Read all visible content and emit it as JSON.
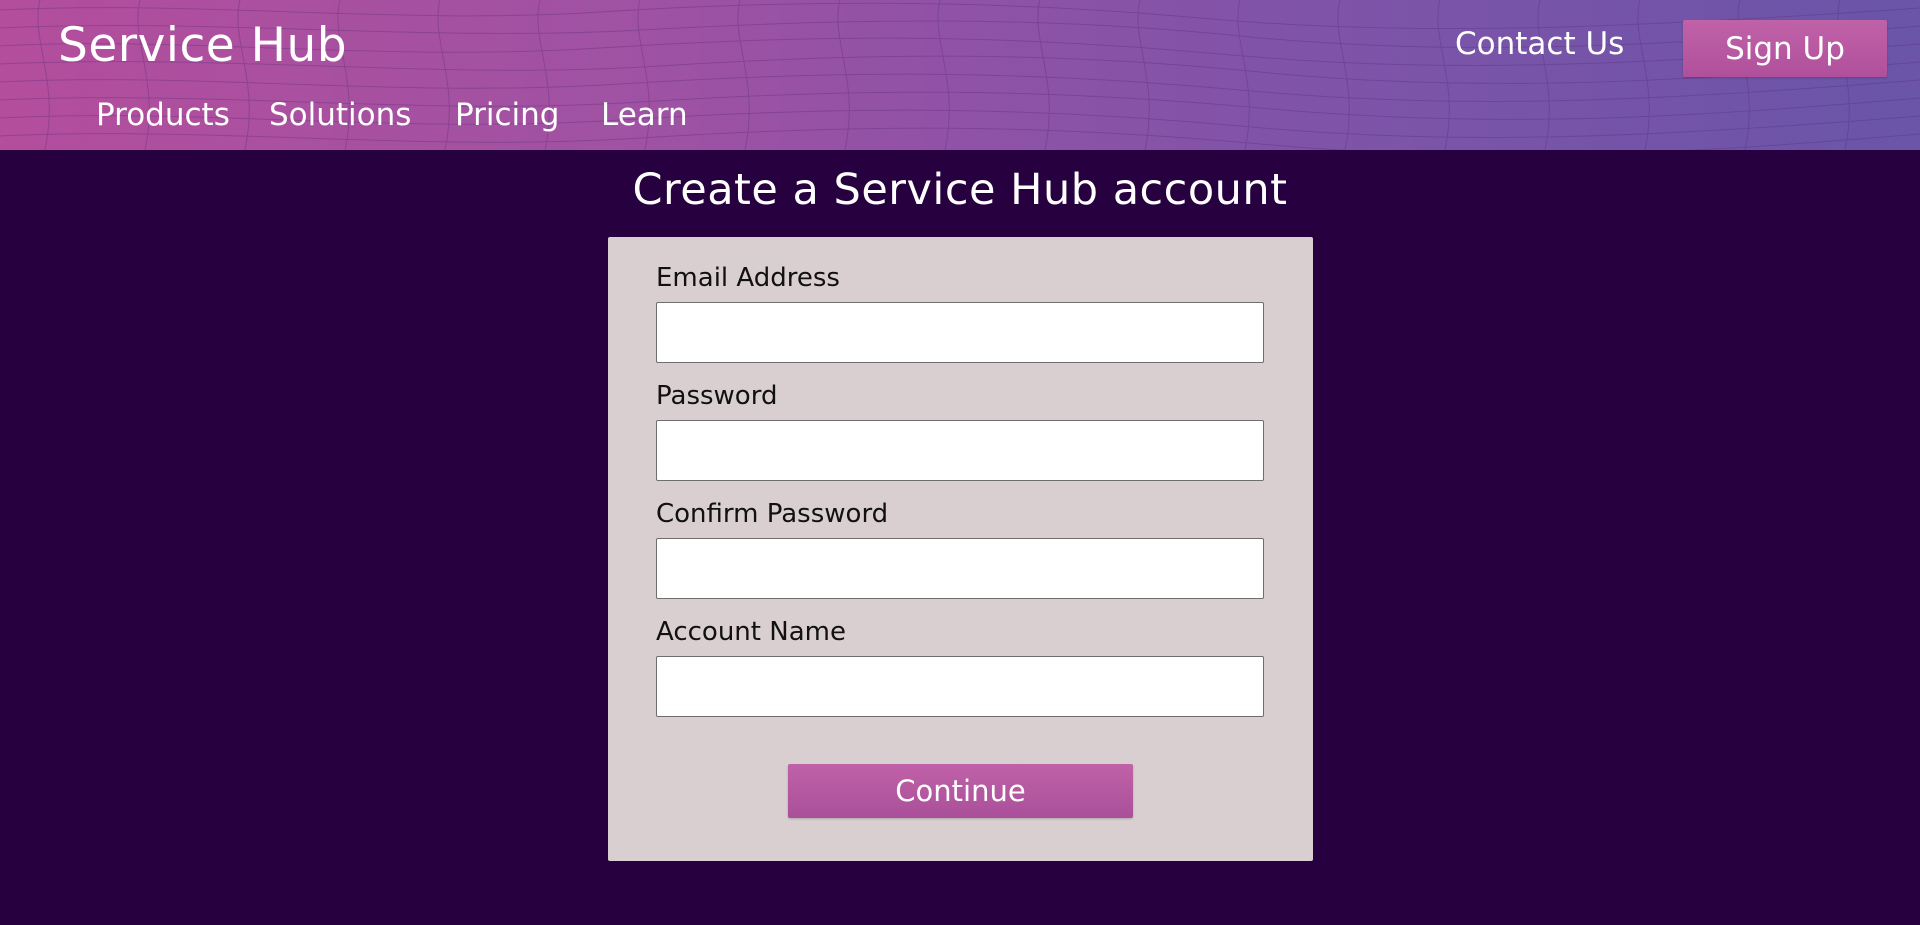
{
  "header": {
    "brand": "Service Hub",
    "nav": [
      {
        "label": "Products"
      },
      {
        "label": "Solutions"
      },
      {
        "label": "Pricing"
      },
      {
        "label": "Learn"
      }
    ],
    "contact_label": "Contact Us",
    "signup_label": "Sign Up"
  },
  "main": {
    "title": "Create a Service Hub account",
    "form": {
      "fields": [
        {
          "label": "Email Address",
          "value": "",
          "placeholder": ""
        },
        {
          "label": "Password",
          "value": "",
          "placeholder": ""
        },
        {
          "label": "Confirm Password",
          "value": "",
          "placeholder": ""
        },
        {
          "label": "Account Name",
          "value": "",
          "placeholder": ""
        }
      ],
      "submit_label": "Continue"
    }
  },
  "colors": {
    "background": "#27003f",
    "header_gradient_start": "#b34e9c",
    "header_gradient_end": "#6a55a8",
    "accent_button": "#b0509c",
    "card_background": "#d9cfd0"
  }
}
